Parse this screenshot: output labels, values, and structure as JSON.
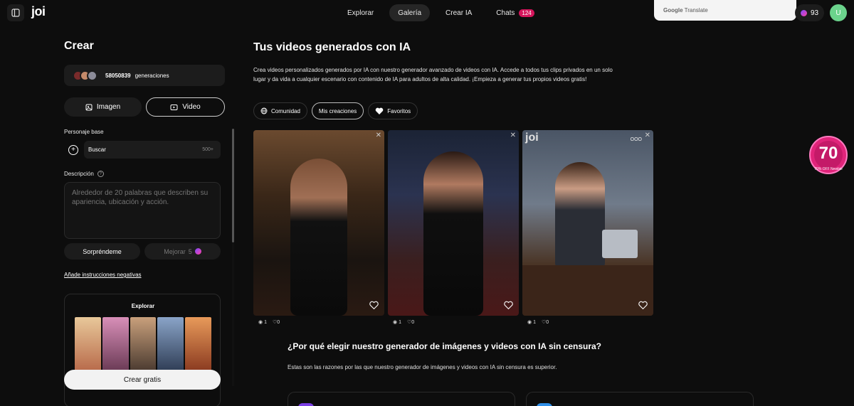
{
  "header": {
    "logo": "joi",
    "nav": [
      {
        "label": "Explorar"
      },
      {
        "label": "Galería",
        "active": true
      },
      {
        "label": "Crear IA"
      },
      {
        "label": "Chats",
        "badge": "124"
      }
    ],
    "translate_brand": "Google",
    "translate_word": "Translate",
    "credits": "93",
    "avatar_initial": "U"
  },
  "left_panel": {
    "title": "Crear",
    "generations_count": "58050839",
    "generations_label": "generaciones",
    "mode_image": "Imagen",
    "mode_video": "Video",
    "base_character_label": "Personaje base",
    "search_label": "Buscar",
    "search_count": "500+",
    "description_label": "Descripción",
    "description_placeholder": "Alrededor de 20 palabras que describen su apariencia, ubicación y acción.",
    "surprise_button": "Sorpréndeme",
    "improve_button": "Mejorar",
    "improve_cost": "5",
    "negative_link": "Añade instrucciones negativas",
    "explore_title": "Explorar",
    "cta": "Crear gratis"
  },
  "main": {
    "title": "Tus videos generados con IA",
    "description": "Crea videos personalizados generados por IA con nuestro generador avanzado de videos con IA. Accede a todos tus clips privados en un solo lugar y da vida a cualquier escenario con contenido de IA para adultos de alta calidad. ¡Empieza a generar tus propios videos gratis!",
    "tabs": [
      {
        "label": "Comunidad",
        "icon": "globe-icon"
      },
      {
        "label": "Mis creaciones",
        "active": true
      },
      {
        "label": "Favoritos",
        "icon": "heart-icon"
      }
    ],
    "cards": [
      {
        "views": "1",
        "likes": "0"
      },
      {
        "views": "1",
        "likes": "0"
      },
      {
        "views": "1",
        "likes": "0",
        "logo": "joi",
        "tag": "OOO"
      }
    ],
    "why_title": "¿Por qué elegir nuestro generador de imágenes y videos con IA sin censura?",
    "why_desc": "Estas son las razones por las que nuestro generador de imágenes y videos con IA sin censura es superior."
  },
  "promo": {
    "value": "70",
    "text": "70% OFF Newbie"
  },
  "colors": {
    "background": "#0d0d0d",
    "accent": "#d4155b",
    "avatar": "#6bd38c"
  }
}
